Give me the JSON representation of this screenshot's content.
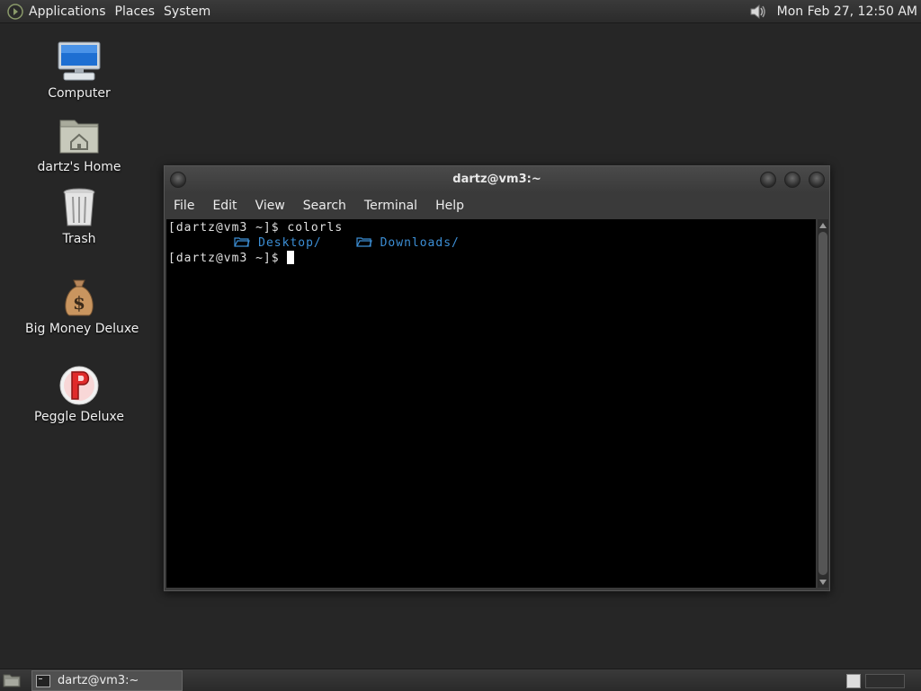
{
  "top_panel": {
    "menus": [
      "Applications",
      "Places",
      "System"
    ],
    "clock": "Mon Feb 27, 12:50 AM",
    "volume_icon": "speaker-icon"
  },
  "desktop_icons": [
    {
      "label": "Computer",
      "icon": "computer-icon"
    },
    {
      "label": "dartz's Home",
      "icon": "home-folder-icon"
    },
    {
      "label": "Trash",
      "icon": "trash-icon"
    },
    {
      "label": "Big Money Deluxe",
      "icon": "money-bag-icon"
    },
    {
      "label": "Peggle Deluxe",
      "icon": "peggle-icon"
    }
  ],
  "terminal": {
    "title": "dartz@vm3:~",
    "menus": [
      "File",
      "Edit",
      "View",
      "Search",
      "Terminal",
      "Help"
    ],
    "prompt": "[dartz@vm3 ~]$",
    "command": "colorls",
    "listing": [
      {
        "icon": "folder-icon",
        "name": "Desktop/"
      },
      {
        "icon": "folder-icon",
        "name": "Downloads/"
      }
    ],
    "colors": {
      "background": "#000000",
      "text": "#e0e0e0",
      "directory": "#3c8fd6"
    }
  },
  "bottom_panel": {
    "task_label": "dartz@vm3:~"
  }
}
